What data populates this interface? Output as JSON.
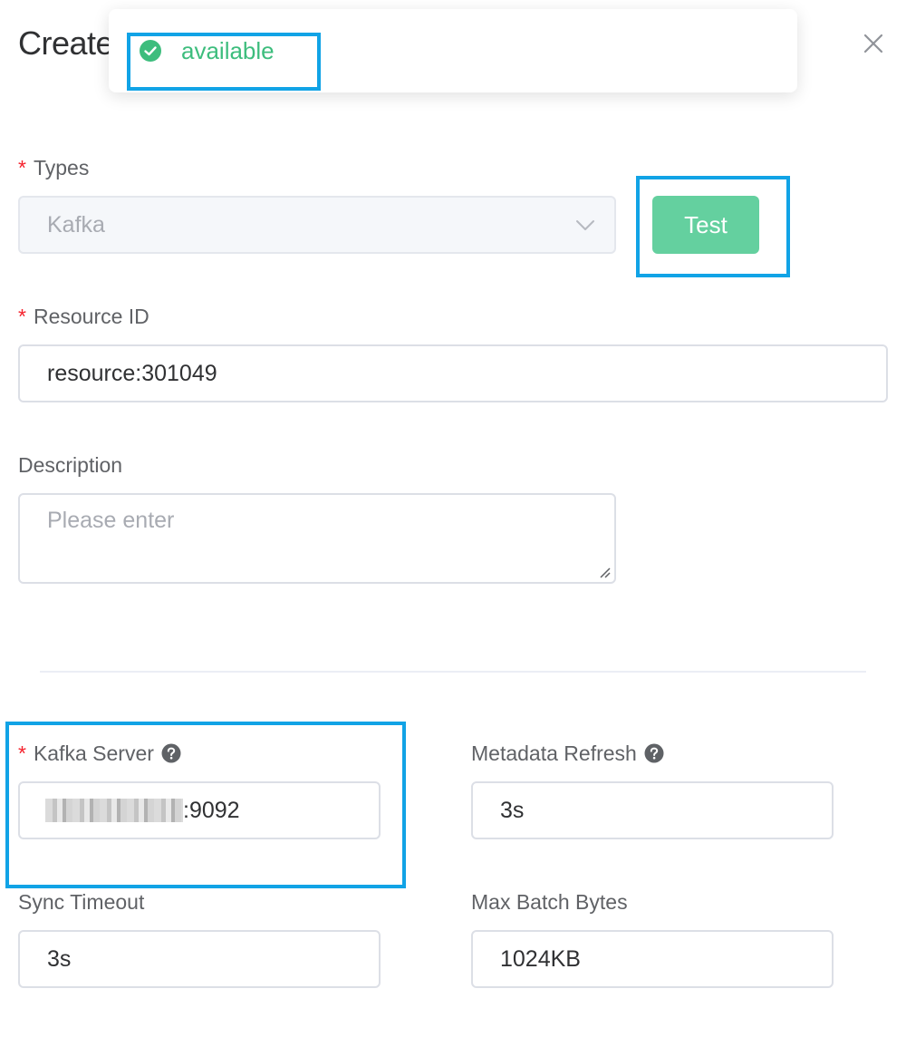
{
  "dialog": {
    "title": "Create"
  },
  "toast": {
    "icon": "check-circle-icon",
    "message": "available",
    "color": "#3dbd7d"
  },
  "form": {
    "types": {
      "label": "Types",
      "required": "*",
      "value": "Kafka"
    },
    "test_button": {
      "label": "Test",
      "color": "#64d09f"
    },
    "resource_id": {
      "label": "Resource ID",
      "required": "*",
      "value": "resource:301049"
    },
    "description": {
      "label": "Description",
      "placeholder": "Please enter"
    },
    "kafka_server": {
      "label": "Kafka Server",
      "required": "*",
      "value_suffix": ":9092",
      "help_icon": "question-circle-icon"
    },
    "metadata_refresh": {
      "label": "Metadata Refresh",
      "value": "3s",
      "help_icon": "question-circle-icon"
    },
    "sync_timeout": {
      "label": "Sync Timeout",
      "value": "3s"
    },
    "max_batch_bytes": {
      "label": "Max Batch Bytes",
      "value": "1024KB"
    }
  },
  "colors": {
    "highlight": "#11a3e6",
    "required": "#f5222d"
  }
}
